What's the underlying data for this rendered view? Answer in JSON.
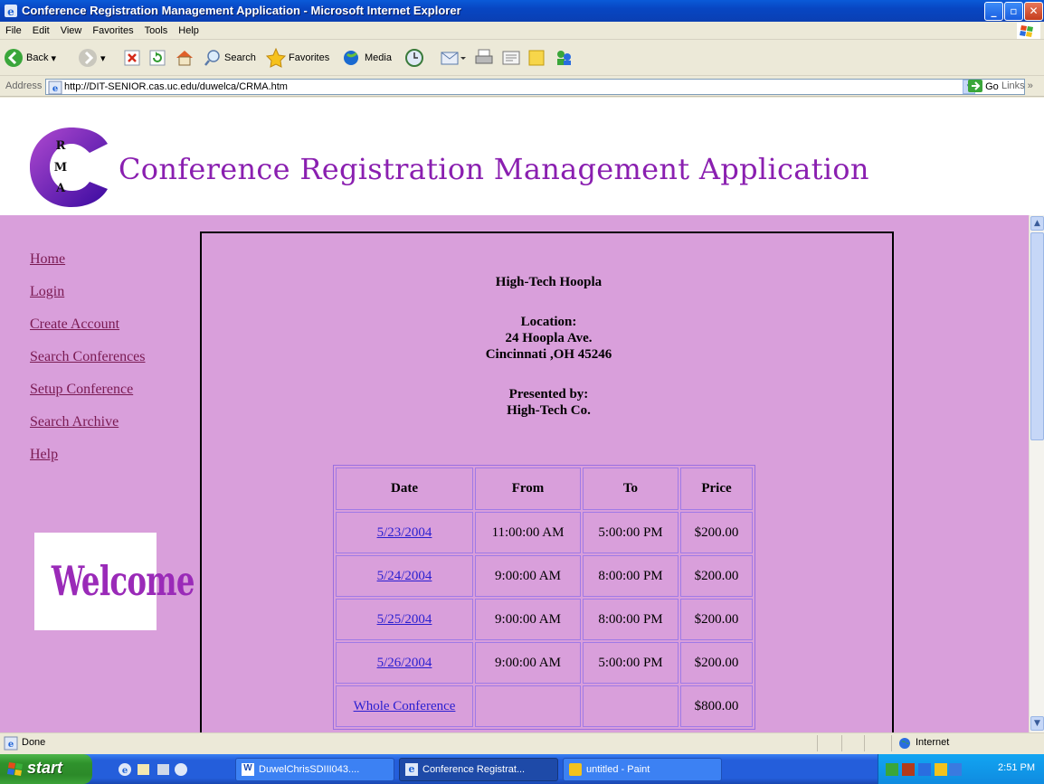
{
  "window": {
    "title": "Conference Registration Management Application - Microsoft Internet Explorer",
    "min": "_",
    "max": "▫",
    "close": "✕"
  },
  "menu": [
    "File",
    "Edit",
    "View",
    "Favorites",
    "Tools",
    "Help"
  ],
  "toolbar": {
    "back": "Back",
    "search": "Search",
    "favorites": "Favorites",
    "media": "Media"
  },
  "address": {
    "label": "Address",
    "url": "http://DIT-SENIOR.cas.uc.edu/duwelca/CRMA.htm",
    "go": "Go",
    "links": "Links"
  },
  "page": {
    "title": "Conference Registration Management Application",
    "logo_letters": [
      "R",
      "M",
      "A"
    ],
    "nav": [
      "Home",
      "Login",
      "Create Account",
      "Search Conferences",
      "Setup Conference",
      "Search Archive",
      "Help"
    ],
    "welcome": "Welcome",
    "conference": {
      "name": "High-Tech Hoopla",
      "location_label": "Location:",
      "address1": "24 Hoopla Ave.",
      "address2": "Cincinnati ,OH 45246",
      "presented_label": "Presented by:",
      "presenter": "High-Tech Co."
    },
    "schedule": {
      "headers": [
        "Date",
        "From",
        "To",
        "Price"
      ],
      "rows": [
        [
          "5/23/2004",
          "11:00:00 AM",
          "5:00:00 PM",
          "$200.00"
        ],
        [
          "5/24/2004",
          "9:00:00 AM",
          "8:00:00 PM",
          "$200.00"
        ],
        [
          "5/25/2004",
          "9:00:00 AM",
          "8:00:00 PM",
          "$200.00"
        ],
        [
          "5/26/2004",
          "9:00:00 AM",
          "5:00:00 PM",
          "$200.00"
        ],
        [
          "Whole Conference",
          "",
          "",
          "$800.00"
        ]
      ]
    }
  },
  "status": {
    "left": "Done",
    "zone": "Internet"
  },
  "taskbar": {
    "start": "start",
    "tasks": [
      "DuwelChrisSDIII043....",
      "Conference Registrat...",
      "untitled - Paint"
    ],
    "clock": "2:51 PM"
  },
  "colors": {
    "page_bg": "#d99fdb",
    "title_purple": "#8a1fb0",
    "nav_link": "#7a1a52",
    "table_link": "#2a1fd0"
  }
}
